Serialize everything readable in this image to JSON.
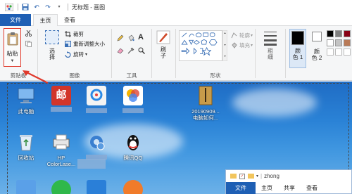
{
  "window": {
    "title": "无标题 - 画图"
  },
  "tabs": {
    "file": "文件",
    "home": "主页",
    "view": "查看"
  },
  "ribbon": {
    "clipboard": {
      "paste_label": "粘贴",
      "group_label": "剪贴板"
    },
    "image": {
      "select_label": "选\n择",
      "crop": "裁剪",
      "resize": "重新调整大小",
      "rotate": "旋转",
      "group_label": "图像"
    },
    "tools": {
      "group_label": "工具"
    },
    "brushes": {
      "label": "刷\n子"
    },
    "shapes": {
      "outline": "轮廓",
      "fill": "填充",
      "group_label": "形状"
    },
    "size": {
      "label": "粗\n细"
    },
    "colors": {
      "color1": "颜\n色 1",
      "color2": "颜\n色 2",
      "color1_value": "#000000",
      "color2_value": "#ffffff"
    }
  },
  "desktop": {
    "icons": [
      {
        "name": "此电脑",
        "color": "#5aa0e8"
      },
      {
        "name": "",
        "color": "#d2352a"
      },
      {
        "name": "",
        "color": "#f3f3f3"
      },
      {
        "name": "",
        "color": "#ffffff"
      },
      {
        "name": "20190909...\n电脑如何...",
        "color": "#c79b4a"
      },
      {
        "name": "回收站",
        "color": "#cfe3f6"
      },
      {
        "name": "HP\nColorLase...",
        "color": "#e6e6e6"
      },
      {
        "name": "",
        "color": "#3a7fd0"
      },
      {
        "name": "腾讯QQ",
        "color": "#111111"
      }
    ]
  },
  "explorer": {
    "path_label": "zhong",
    "tabs": [
      "文件",
      "主页",
      "共享",
      "查看"
    ]
  }
}
